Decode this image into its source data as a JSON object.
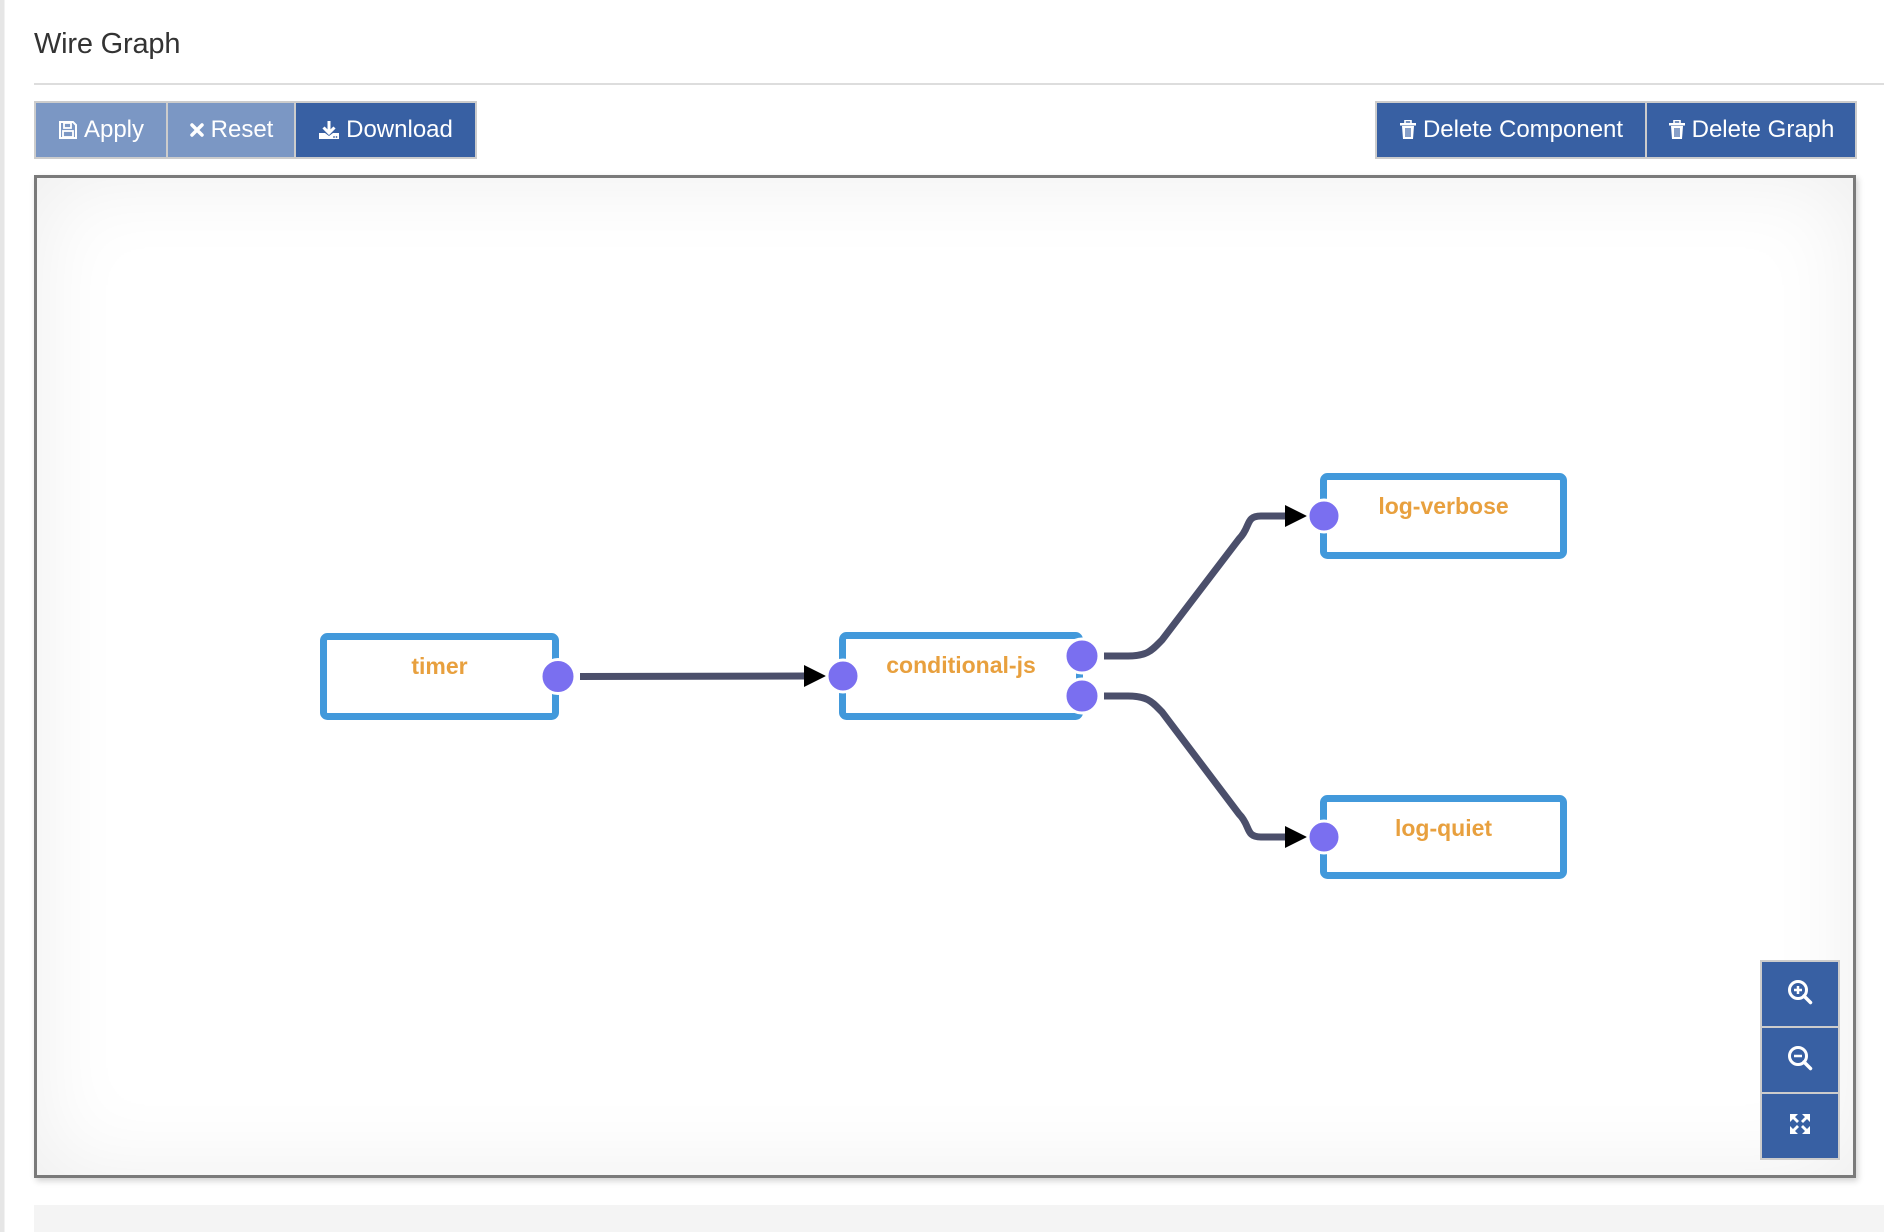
{
  "page": {
    "title": "Wire Graph"
  },
  "toolbar": {
    "left": [
      {
        "id": "apply",
        "label": "Apply",
        "icon": "save-icon",
        "disabled": true
      },
      {
        "id": "reset",
        "label": "Reset",
        "icon": "close-icon",
        "disabled": true
      },
      {
        "id": "download",
        "label": "Download",
        "icon": "download-icon",
        "disabled": false
      }
    ],
    "right": [
      {
        "id": "delete-component",
        "label": "Delete Component",
        "icon": "trash-icon",
        "disabled": false
      },
      {
        "id": "delete-graph",
        "label": "Delete Graph",
        "icon": "trash-icon",
        "disabled": false
      }
    ]
  },
  "graph": {
    "nodes": [
      {
        "id": "timer",
        "label": "timer",
        "inputs": 0,
        "outputs": 1
      },
      {
        "id": "conditional-js",
        "label": "conditional-js",
        "inputs": 1,
        "outputs": 2
      },
      {
        "id": "log-verbose",
        "label": "log-verbose",
        "inputs": 1,
        "outputs": 0
      },
      {
        "id": "log-quiet",
        "label": "log-quiet",
        "inputs": 1,
        "outputs": 0
      }
    ],
    "edges": [
      {
        "from": "timer",
        "from_port": 0,
        "to": "conditional-js",
        "to_port": 0
      },
      {
        "from": "conditional-js",
        "from_port": 0,
        "to": "log-verbose",
        "to_port": 0
      },
      {
        "from": "conditional-js",
        "from_port": 1,
        "to": "log-quiet",
        "to_port": 0
      }
    ]
  },
  "zoom_controls": [
    {
      "id": "zoom-in",
      "icon": "zoom-in-icon"
    },
    {
      "id": "zoom-out",
      "icon": "zoom-out-icon"
    },
    {
      "id": "fit",
      "icon": "expand-icon"
    }
  ],
  "colors": {
    "button_primary": "#3860a3",
    "button_disabled": "#7b97c4",
    "node_border": "#4299db",
    "node_label": "#e8a03e",
    "port": "#7a6ff0",
    "wire": "#4b4f6b",
    "arrow": "#000000"
  }
}
